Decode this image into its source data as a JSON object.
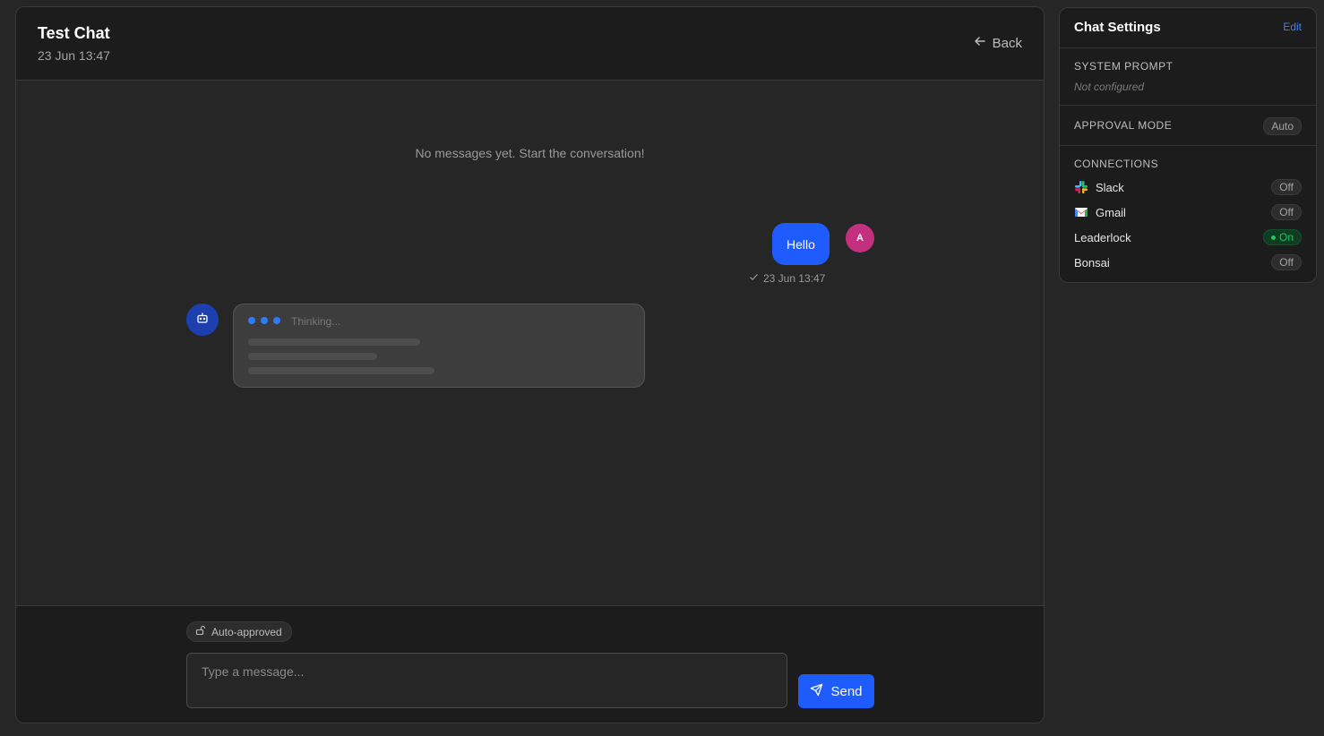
{
  "chat": {
    "title": "Test Chat",
    "date": "23 Jun 13:47",
    "back_label": "Back"
  },
  "messages": {
    "empty_note": "No messages yet. Start the conversation!",
    "user_message": "Hello",
    "user_avatar_initial": "A",
    "user_message_time": "23 Jun 13:47",
    "thinking_label": "Thinking..."
  },
  "composer": {
    "badge_label": "Auto-approved",
    "input_placeholder": "Type a message...",
    "input_value": "",
    "send_label": "Send"
  },
  "settings": {
    "title": "Chat Settings",
    "edit_label": "Edit",
    "system_prompt_label": "SYSTEM PROMPT",
    "system_prompt_value": "Not configured",
    "approval_mode_label": "APPROVAL MODE",
    "approval_mode_value": "Auto",
    "connections_label": "CONNECTIONS",
    "connections": [
      {
        "name": "Slack",
        "status": "Off",
        "icon": "slack-icon"
      },
      {
        "name": "Gmail",
        "status": "Off",
        "icon": "gmail-icon"
      },
      {
        "name": "Leaderlock",
        "status": "On",
        "icon": ""
      },
      {
        "name": "Bonsai",
        "status": "Off",
        "icon": ""
      }
    ]
  },
  "colors": {
    "accent": "#1f5cff",
    "user_avatar": "#c2307f",
    "bot_avatar": "#1d3fb0",
    "on_status": "#22c55e",
    "link": "#3b82f6"
  }
}
